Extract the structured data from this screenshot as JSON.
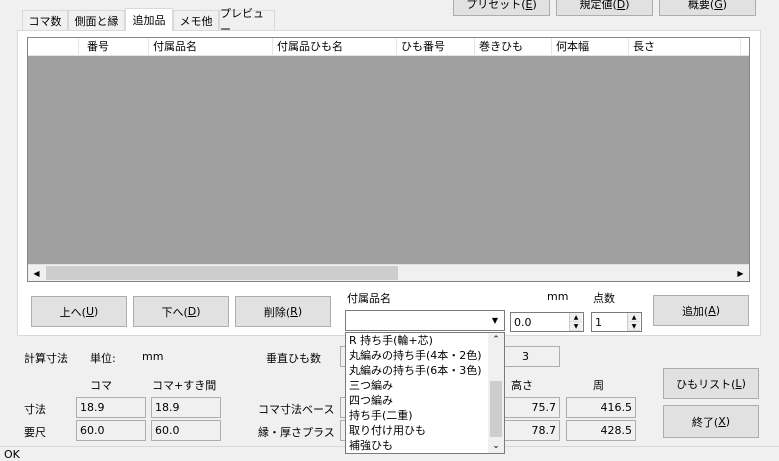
{
  "top_buttons": [
    {
      "label": "プリセット(",
      "key": "E",
      "suffix": ")"
    },
    {
      "label": "規定値(",
      "key": "D",
      "suffix": ")"
    },
    {
      "label": "概要(",
      "key": "G",
      "suffix": ")"
    }
  ],
  "tabs": [
    "コマ数",
    "側面と縁",
    "追加品",
    "メモ他",
    "プレビュー"
  ],
  "active_tab": "追加品",
  "grid": {
    "columns": [
      "",
      "番号",
      "付属品名",
      "付属品ひも名",
      "ひも番号",
      "巻きひも",
      "何本幅",
      "長さ"
    ]
  },
  "buttons": {
    "up": {
      "text": "上へ(",
      "key": "U",
      "suffix": ")"
    },
    "down": {
      "text": "下へ(",
      "key": "D",
      "suffix": ")"
    },
    "delete": {
      "text": "削除(",
      "key": "R",
      "suffix": ")"
    },
    "add": {
      "text": "追加(",
      "key": "A",
      "suffix": ")"
    },
    "string_list": {
      "text": "ひもリスト(",
      "key": "L",
      "suffix": ")"
    },
    "exit": {
      "text": "終了(",
      "key": "X",
      "suffix": ")"
    }
  },
  "accessory": {
    "label": "付属品名",
    "value": "",
    "mm_label": "mm",
    "points_label": "点数",
    "mm_value": "0.0",
    "points_value": "1"
  },
  "dropdown": {
    "items": [
      "R 持ち手(輪+芯)",
      "丸編みの持ち手(4本・2色)",
      "丸編みの持ち手(6本・3色)",
      "三つ編み",
      "四つ編み",
      "持ち手(二重)",
      "取り付け用ひも",
      "補強ひも"
    ]
  },
  "calc": {
    "title": "計算寸法",
    "unit_label": "単位:",
    "unit_value": "mm",
    "vertical_label": "垂直ひも数",
    "vertical_value": "3",
    "col_koma": "コマ",
    "col_koma_gap": "コマ+すき間",
    "col_height": "高さ",
    "col_perimeter": "周",
    "row_size": "寸法",
    "row_required": "要尺",
    "size_koma": "18.9",
    "size_koma_gap": "18.9",
    "req_koma": "60.0",
    "req_koma_gap": "60.0",
    "base_label": "コマ寸法ベース",
    "edge_label": "縁・厚さプラス",
    "height_1": "75.7",
    "perimeter_1": "416.5",
    "height_2": "78.7",
    "perimeter_2": "428.5"
  },
  "status": "OK"
}
